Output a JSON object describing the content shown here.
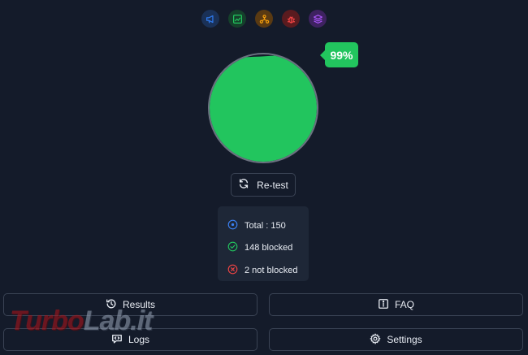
{
  "category_icons": [
    {
      "name": "megaphone-icon",
      "color": "#2f7bf0",
      "bg": "#1a3157"
    },
    {
      "name": "chart-line-icon",
      "color": "#22c55e",
      "bg": "#15402b"
    },
    {
      "name": "network-icon",
      "color": "#f59e0b",
      "bg": "#5a3a12"
    },
    {
      "name": "bug-icon",
      "color": "#ef4444",
      "bg": "#5a1b1f"
    },
    {
      "name": "layers-icon",
      "color": "#a855f7",
      "bg": "#3e2260"
    }
  ],
  "score": {
    "label": "99%",
    "value": 99,
    "fill_color": "#22c55e",
    "ring_color": "#6b7280"
  },
  "retest": {
    "label": "Re-test",
    "icon": "refresh-icon"
  },
  "stats": {
    "total": "Total : 150",
    "blocked": "148 blocked",
    "not_blocked": "2 not blocked",
    "total_color": "#3b82f6",
    "blocked_color": "#22c55e",
    "not_blocked_color": "#ef4444"
  },
  "nav": {
    "results": "Results",
    "faq": "FAQ",
    "logs": "Logs",
    "settings": "Settings"
  },
  "watermark": {
    "part1": "Turbo",
    "part2": "Lab.it"
  }
}
